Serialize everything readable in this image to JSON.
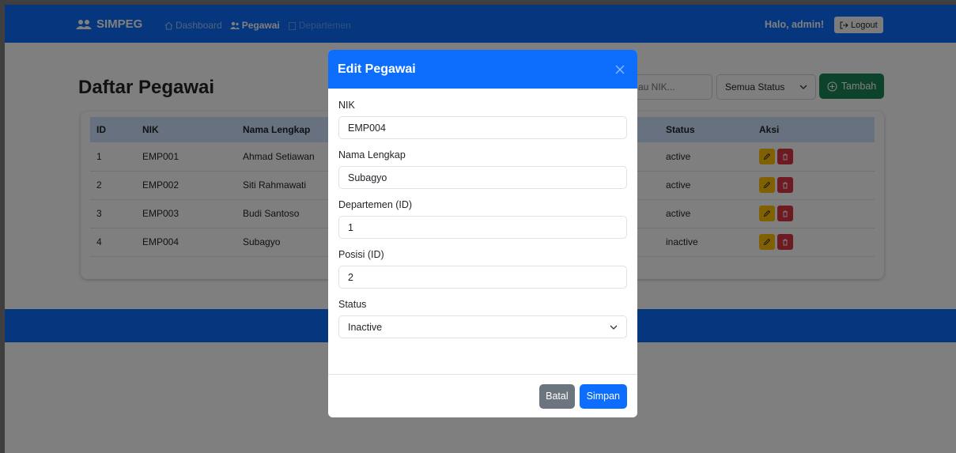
{
  "navbar": {
    "brand": "SIMPEG",
    "links": [
      {
        "label": "Dashboard",
        "icon": "home-icon",
        "state": "inactive"
      },
      {
        "label": "Pegawai",
        "icon": "users-icon",
        "state": "active"
      },
      {
        "label": "Departemen",
        "icon": "building-icon",
        "state": "disabled"
      }
    ],
    "greeting": "Halo, admin!",
    "logout_label": "Logout"
  },
  "page": {
    "title": "Daftar Pegawai",
    "search_value": "au NIK...",
    "status_filter": "Semua Status",
    "add_label": "Tambah"
  },
  "table": {
    "headers": [
      "ID",
      "NIK",
      "Nama Lengkap",
      "Status",
      "Aksi"
    ],
    "rows": [
      {
        "id": "1",
        "nik": "EMP001",
        "name": "Ahmad Setiawan",
        "status": "active"
      },
      {
        "id": "2",
        "nik": "EMP002",
        "name": "Siti Rahmawati",
        "status": "active"
      },
      {
        "id": "3",
        "nik": "EMP003",
        "name": "Budi Santoso",
        "status": "active"
      },
      {
        "id": "4",
        "nik": "EMP004",
        "name": "Subagyo",
        "status": "inactive"
      }
    ]
  },
  "modal": {
    "title": "Edit Pegawai",
    "fields": {
      "nik": {
        "label": "NIK",
        "value": "EMP004"
      },
      "nama": {
        "label": "Nama Lengkap",
        "value": "Subagyo"
      },
      "departemen": {
        "label": "Departemen (ID)",
        "value": "1"
      },
      "posisi": {
        "label": "Posisi (ID)",
        "value": "2"
      },
      "status": {
        "label": "Status",
        "value": "Inactive"
      }
    },
    "cancel_label": "Batal",
    "save_label": "Simpan"
  },
  "colors": {
    "primary": "#0d6efd",
    "success": "#198754",
    "warning": "#ffc107",
    "danger": "#dc3545",
    "secondary": "#6c757d",
    "table_header": "#cfe2ff"
  }
}
